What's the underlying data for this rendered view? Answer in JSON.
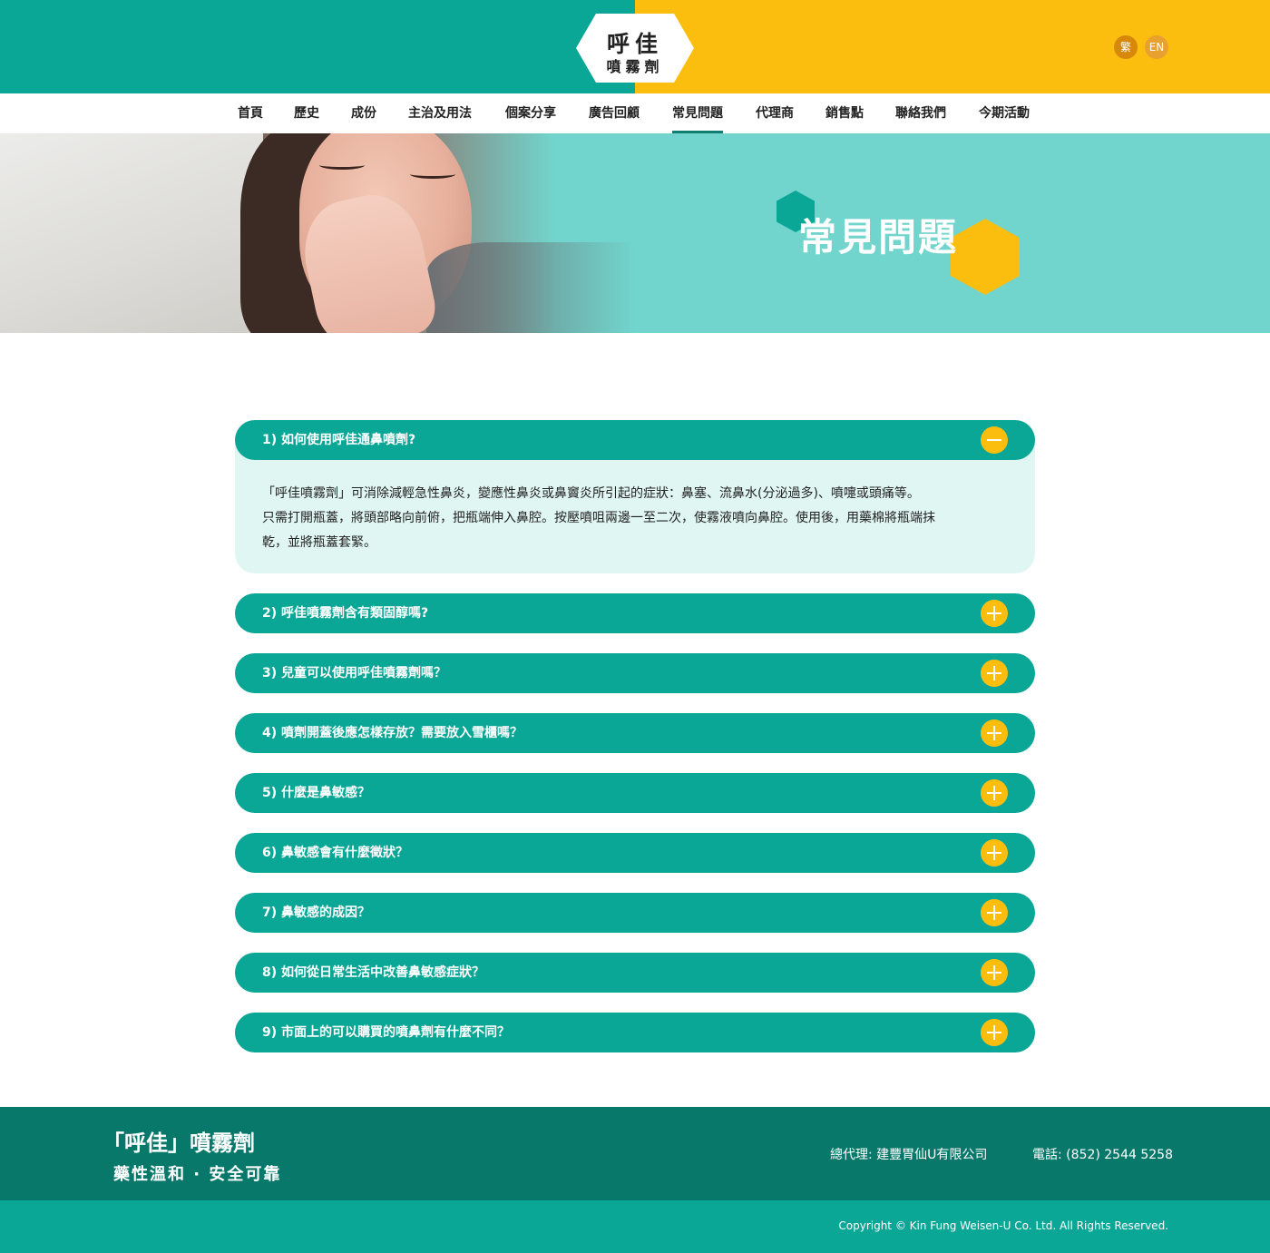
{
  "colors": {
    "teal": "#0aa696",
    "yellow": "#fbbe0f",
    "banner": "#71d5cd",
    "dark_teal": "#08786b",
    "answer_bg": "#e0f6f3"
  },
  "logo": {
    "line1": "呼佳",
    "line2": "噴霧劑"
  },
  "lang": {
    "zh": "繁",
    "en": "EN"
  },
  "nav": {
    "items": [
      "首頁",
      "歷史",
      "成份",
      "主治及用法",
      "個案分享",
      "廣告回顧",
      "常見問題",
      "代理商",
      "銷售點",
      "聯絡我們",
      "今期活動"
    ],
    "active": "常見問題"
  },
  "banner": {
    "title": "常見問題"
  },
  "faq": {
    "items": [
      {
        "question": "1) 如何使用呼佳通鼻噴劑?",
        "expanded": true,
        "toggle_icon": "minus-icon"
      },
      {
        "question": "2) 呼佳噴霧劑含有類固醇嗎?",
        "expanded": false,
        "toggle_icon": "plus-icon"
      },
      {
        "question": "3) 兒童可以使用呼佳噴霧劑嗎？",
        "expanded": false,
        "toggle_icon": "plus-icon"
      },
      {
        "question": "4) 噴劑開蓋後應怎樣存放？需要放入雪櫃嗎？",
        "expanded": false,
        "toggle_icon": "plus-icon"
      },
      {
        "question": "5) 什麼是鼻敏感？",
        "expanded": false,
        "toggle_icon": "plus-icon"
      },
      {
        "question": "6) 鼻敏感會有什麼徵狀？",
        "expanded": false,
        "toggle_icon": "plus-icon"
      },
      {
        "question": "7) 鼻敏感的成因？",
        "expanded": false,
        "toggle_icon": "plus-icon"
      },
      {
        "question": "8) 如何從日常生活中改善鼻敏感症狀？",
        "expanded": false,
        "toggle_icon": "plus-icon"
      },
      {
        "question": "9) 市面上的可以購買的噴鼻劑有什麼不同？",
        "expanded": false,
        "toggle_icon": "plus-icon"
      }
    ],
    "answer1": {
      "line1": "「呼佳噴霧劑」可消除減輕急性鼻炎，變應性鼻炎或鼻竇炎所引起的症狀：鼻塞、流鼻水(分泌過多)、噴嚏或頭痛等。",
      "line2": "只需打開瓶蓋，將頭部略向前俯，把瓶端伸入鼻腔。按壓噴咀兩邊一至二次，使霧液噴向鼻腔。使用後，用藥棉將瓶端抹",
      "line3": "乾，並將瓶蓋套緊。"
    }
  },
  "footer": {
    "brand": "「呼佳」噴霧劑",
    "slogan": "藥性溫和 · 安全可靠",
    "agent": "總代理: 建豐胃仙U有限公司",
    "phone": "電話: (852) 2544 5258",
    "copyright": "Copyright © Kin Fung Weisen-U Co. Ltd. All Rights Reserved."
  }
}
